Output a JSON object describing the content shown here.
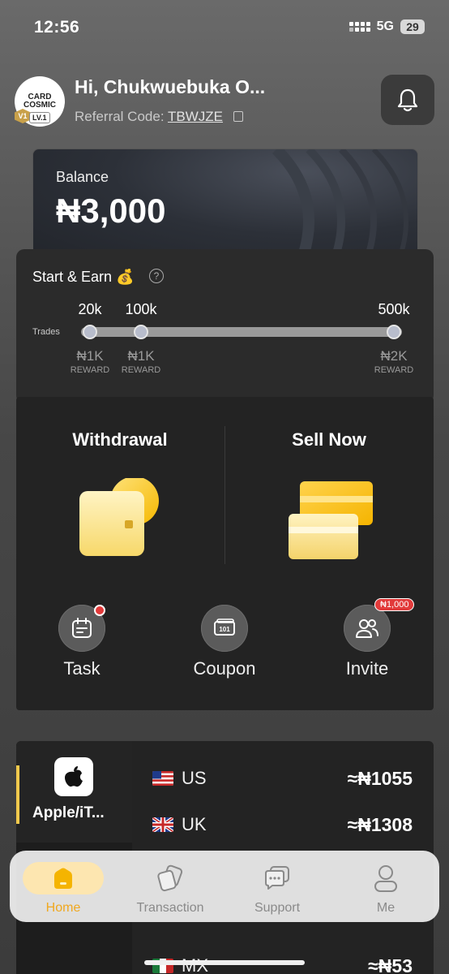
{
  "status_bar": {
    "time": "12:56",
    "network": "5G",
    "battery": "29"
  },
  "header": {
    "avatar_logo": "CARD COSMIC",
    "avatar_badge": "V1",
    "avatar_level": "LV.1",
    "greeting": "Hi, Chukwuebuka O...",
    "referral_label": "Referral Code:",
    "referral_code": "TBWJZE"
  },
  "balance": {
    "label": "Balance",
    "amount": "₦3,000"
  },
  "start_earn": {
    "title": "Start & Earn 💰",
    "trades_label": "Trades",
    "progress": 0,
    "milestones": [
      {
        "trades": "20k",
        "reward": "₦1K",
        "reward_label": "REWARD"
      },
      {
        "trades": "100k",
        "reward": "₦1K",
        "reward_label": "REWARD"
      },
      {
        "trades": "500k",
        "reward": "₦2K",
        "reward_label": "REWARD"
      }
    ]
  },
  "actions": {
    "withdrawal_label": "Withdrawal",
    "sell_label": "Sell Now",
    "quick": [
      {
        "label": "Task",
        "icon": "calendar-icon"
      },
      {
        "label": "Coupon",
        "icon": "ticket-icon"
      },
      {
        "label": "Invite",
        "icon": "users-icon",
        "badge": "₦1,000"
      }
    ]
  },
  "rates": {
    "category": "Apple/iT...",
    "rows": [
      {
        "country": "US",
        "rate": "≈₦1055"
      },
      {
        "country": "UK",
        "rate": "≈₦1308"
      },
      {
        "country": "MX",
        "rate": "≈₦53"
      }
    ]
  },
  "tabs": [
    {
      "label": "Home",
      "icon": "home-icon",
      "active": true
    },
    {
      "label": "Transaction",
      "icon": "transaction-icon",
      "active": false
    },
    {
      "label": "Support",
      "icon": "support-icon",
      "active": false
    },
    {
      "label": "Me",
      "icon": "profile-icon",
      "active": false
    }
  ],
  "colors": {
    "accent": "#f2c94c",
    "badge_red": "#e23a3a",
    "tab_active": "#f0a81e"
  }
}
